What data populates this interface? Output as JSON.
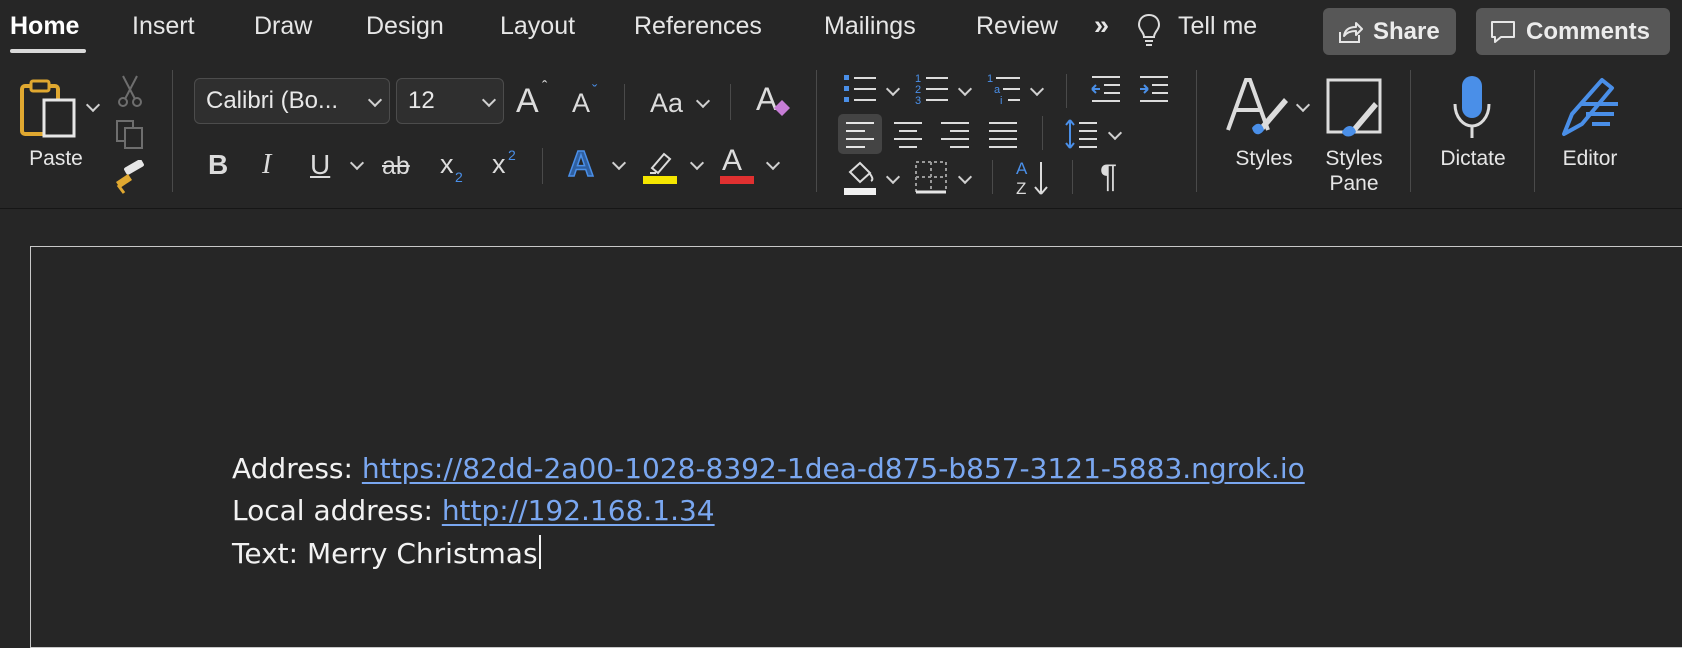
{
  "tabs": [
    {
      "label": "Home",
      "active": true
    },
    {
      "label": "Insert"
    },
    {
      "label": "Draw"
    },
    {
      "label": "Design"
    },
    {
      "label": "Layout"
    },
    {
      "label": "References"
    },
    {
      "label": "Mailings"
    },
    {
      "label": "Review"
    }
  ],
  "more_tabs_glyph": "»",
  "tell_me": "Tell me",
  "header_buttons": {
    "share": "Share",
    "comments": "Comments"
  },
  "clipboard": {
    "paste_label": "Paste"
  },
  "font": {
    "family": "Calibri (Bo...",
    "size": "12",
    "change_case": "Aa"
  },
  "format_glyphs": {
    "bold": "B",
    "italic": "I",
    "underline": "U",
    "strike": "ab",
    "subscript": "x",
    "subscript_mark": "2",
    "superscript": "x",
    "superscript_mark": "2",
    "text_effects": "A",
    "font_color": "A",
    "grow": "A",
    "shrink": "A",
    "pilcrow": "¶",
    "sort_a": "A",
    "sort_z": "Z"
  },
  "colors": {
    "highlight": "#f5e600",
    "font_color": "#e03030",
    "accent_blue": "#4a8fe8",
    "link": "#7aa7f0"
  },
  "big_buttons": {
    "styles": "Styles",
    "styles_pane_1": "Styles",
    "styles_pane_2": "Pane",
    "dictate": "Dictate",
    "editor": "Editor"
  },
  "document": {
    "line1_prefix": "Address: ",
    "line1_link": "https://82dd-2a00-1028-8392-1dea-d875-b857-3121-5883.ngrok.io",
    "line2_prefix": "Local address: ",
    "line2_link": "http://192.168.1.34",
    "line3": "Text: Merry Christmas"
  }
}
